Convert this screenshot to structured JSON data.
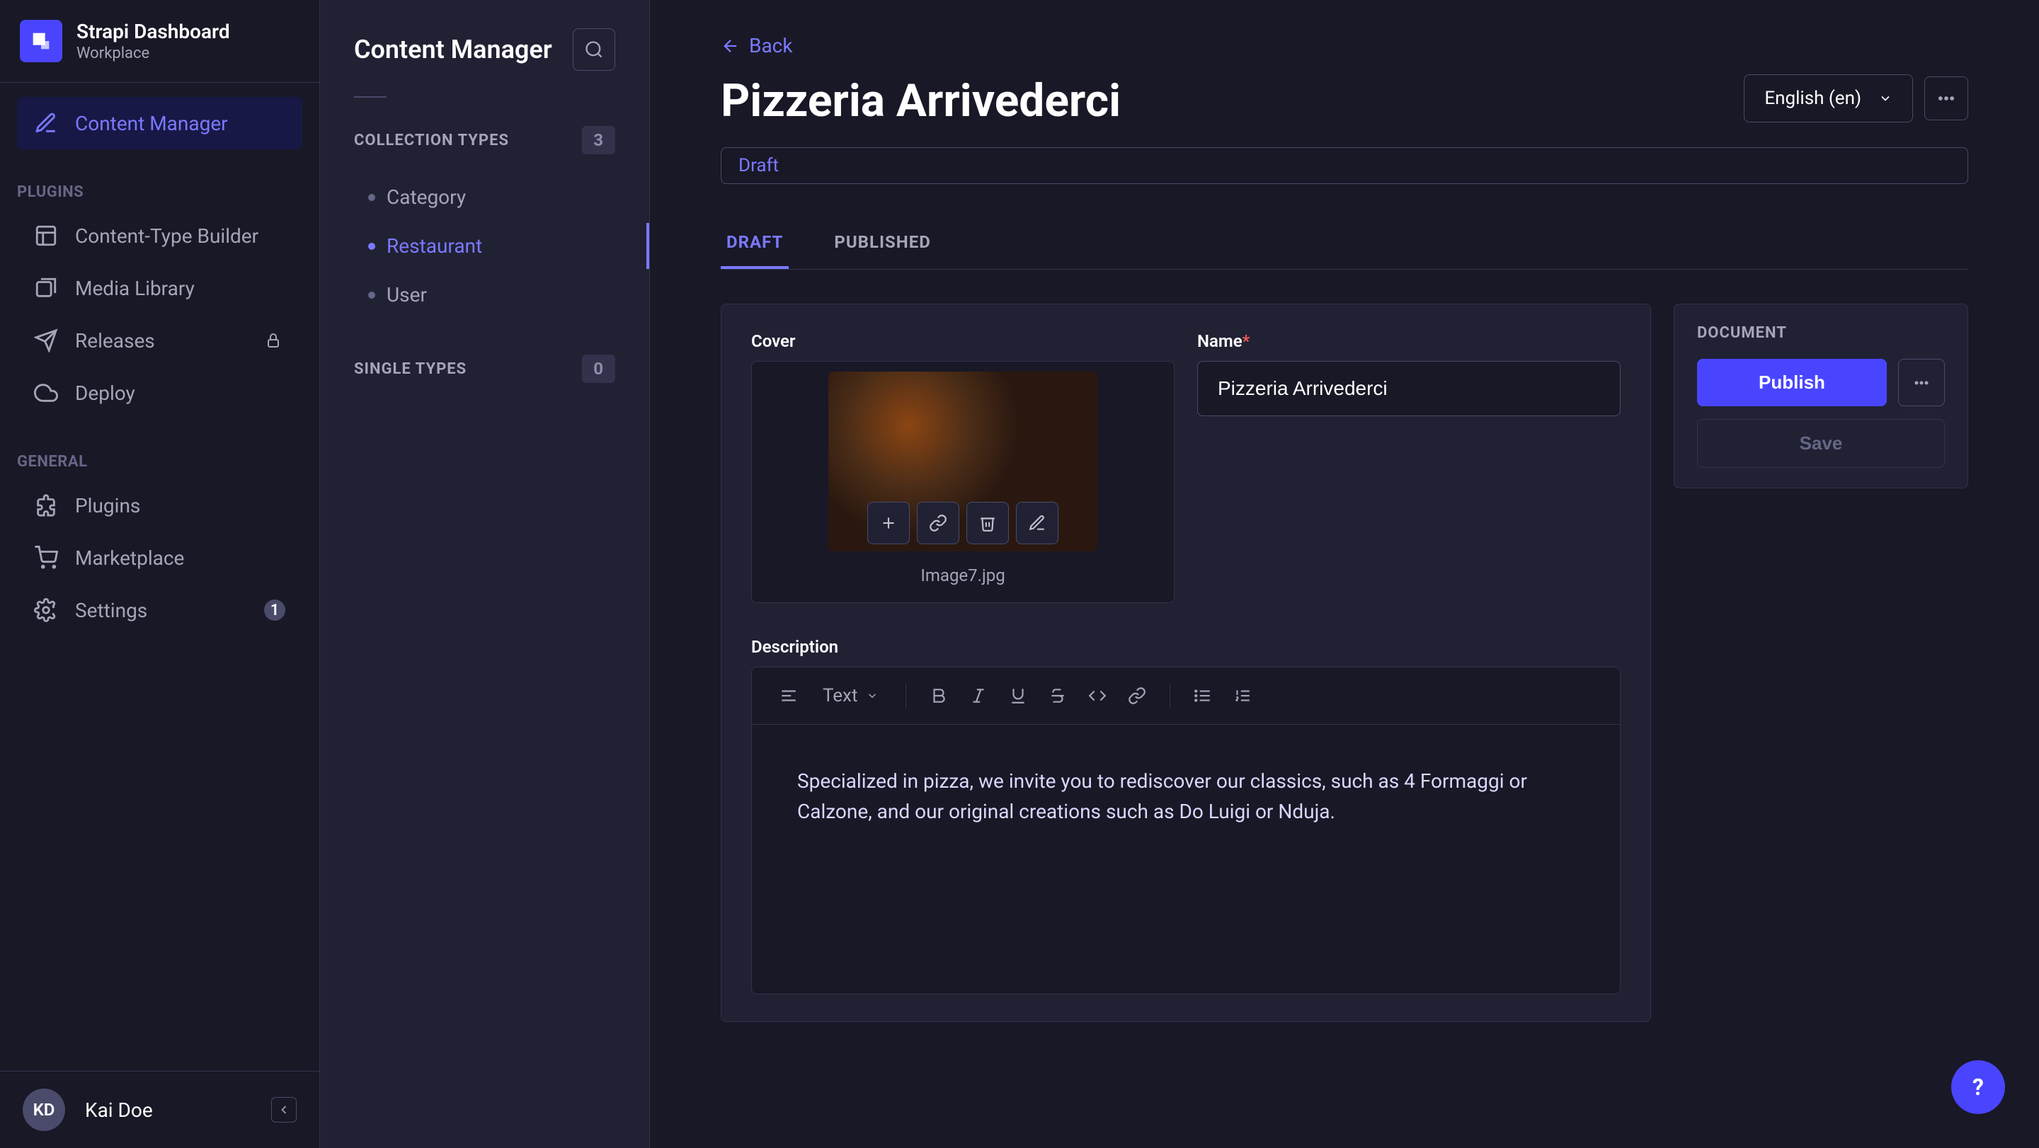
{
  "brand": {
    "title": "Strapi Dashboard",
    "subtitle": "Workplace"
  },
  "nav": {
    "content_manager": "Content Manager",
    "plugins_heading": "PLUGINS",
    "content_type_builder": "Content-Type Builder",
    "media_library": "Media Library",
    "releases": "Releases",
    "deploy": "Deploy",
    "general_heading": "GENERAL",
    "plugins": "Plugins",
    "marketplace": "Marketplace",
    "settings": "Settings",
    "settings_badge": "1"
  },
  "user": {
    "initials": "KD",
    "name": "Kai Doe"
  },
  "types_panel": {
    "title": "Content Manager",
    "collection_heading": "COLLECTION TYPES",
    "collection_count": "3",
    "collection_items": [
      "Category",
      "Restaurant",
      "User"
    ],
    "single_heading": "SINGLE TYPES",
    "single_count": "0"
  },
  "page": {
    "back": "Back",
    "title": "Pizzeria Arrivederci",
    "locale": "English (en)",
    "status": "Draft",
    "tabs": {
      "draft": "DRAFT",
      "published": "PUBLISHED"
    }
  },
  "fields": {
    "cover_label": "Cover",
    "cover_filename": "Image7.jpg",
    "name_label": "Name",
    "name_value": "Pizzeria Arrivederci",
    "description_label": "Description",
    "text_dropdown": "Text",
    "description_body": "Specialized in pizza, we invite you to rediscover our classics, such as 4 Formaggi or Calzone, and our original creations such as Do Luigi or Nduja."
  },
  "side": {
    "document_label": "DOCUMENT",
    "publish": "Publish",
    "save": "Save"
  },
  "help": "?"
}
